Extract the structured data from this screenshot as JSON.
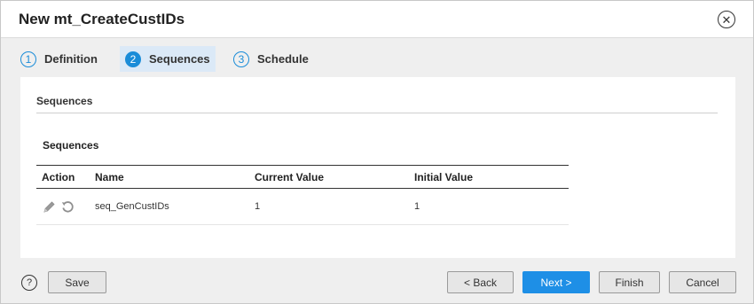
{
  "dialog": {
    "title": "New mt_CreateCustIDs",
    "close_symbol": "✕"
  },
  "steps": [
    {
      "number": "1",
      "label": "Definition",
      "active": false
    },
    {
      "number": "2",
      "label": "Sequences",
      "active": true
    },
    {
      "number": "3",
      "label": "Schedule",
      "active": false
    }
  ],
  "section": {
    "header": "Sequences",
    "table_title": "Sequences",
    "columns": [
      "Action",
      "Name",
      "Current Value",
      "Initial Value"
    ],
    "rows": [
      {
        "name": "seq_GenCustIDs",
        "current_value": "1",
        "initial_value": "1",
        "action_icons": [
          "edit-pencil-icon",
          "reset-icon"
        ]
      }
    ]
  },
  "footer": {
    "help_symbol": "?",
    "save_label": "Save",
    "back_label": "< Back",
    "next_label": "Next >",
    "finish_label": "Finish",
    "cancel_label": "Cancel"
  },
  "colors": {
    "accent": "#1a8cd8",
    "primary_button": "#1e8fe6",
    "active_step_bg": "#dbe9f7",
    "background": "#efefef"
  }
}
